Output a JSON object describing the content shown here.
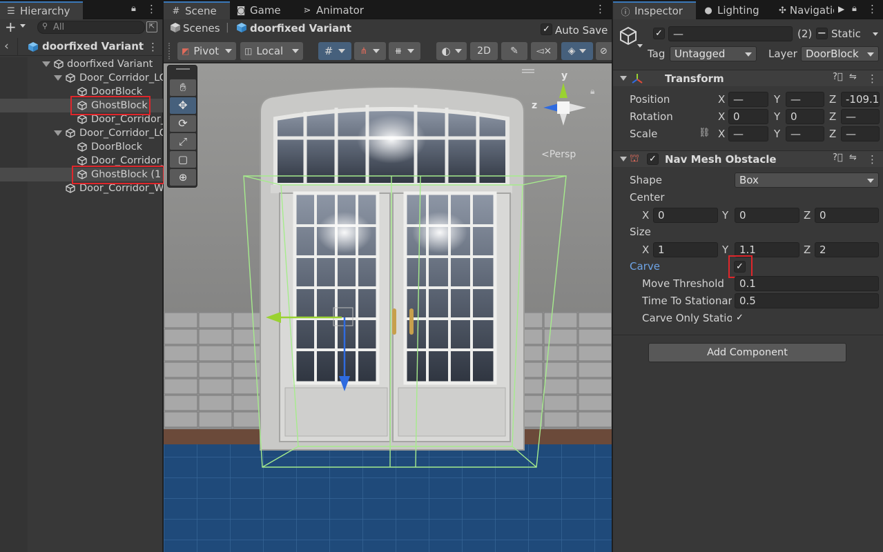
{
  "hierarchy": {
    "tab_label": "Hierarchy",
    "search_placeholder": "All",
    "breadcrumb": "doorfixed Variant",
    "rows": [
      {
        "label": "doorfixed Variant"
      },
      {
        "label": "Door_Corridor_LO"
      },
      {
        "label": "DoorBlock"
      },
      {
        "label": "GhostBlock"
      },
      {
        "label": "Door_Corridor_"
      },
      {
        "label": "Door_Corridor_LO"
      },
      {
        "label": "DoorBlock"
      },
      {
        "label": "Door_Corridor_"
      },
      {
        "label": "GhostBlock (1"
      },
      {
        "label": "Door_Corridor_Wa"
      }
    ]
  },
  "scene": {
    "tabs": [
      {
        "label": "Scene"
      },
      {
        "label": "Game"
      },
      {
        "label": "Animator"
      }
    ],
    "breadcrumb_scenes": "Scenes",
    "breadcrumb_prefab": "doorfixed Variant",
    "auto_save_label": "Auto Save",
    "auto_save_checked": true,
    "toolbar": {
      "pivot": "Pivot",
      "local": "Local",
      "mode_2d": "2D"
    },
    "gizmo": {
      "y_label": "y",
      "z_label": "z",
      "projection": "<Persp"
    }
  },
  "inspector": {
    "tabs": [
      {
        "label": "Inspector"
      },
      {
        "label": "Lighting"
      },
      {
        "label": "Navigatio"
      }
    ],
    "object": {
      "name_value": "—",
      "count": "(2)",
      "static_label": "Static",
      "tag_label": "Tag",
      "tag_value": "Untagged",
      "layer_label": "Layer",
      "layer_value": "DoorBlock"
    },
    "transform": {
      "title": "Transform",
      "position_label": "Position",
      "rotation_label": "Rotation",
      "scale_label": "Scale",
      "position": {
        "x": "—",
        "y": "—",
        "z": "-109.1"
      },
      "rotation": {
        "x": "0",
        "y": "0",
        "z": "—"
      },
      "scale": {
        "x": "—",
        "y": "—",
        "z": "—"
      }
    },
    "navmesh": {
      "title": "Nav Mesh Obstacle",
      "shape_label": "Shape",
      "shape_value": "Box",
      "center_label": "Center",
      "center": {
        "x": "0",
        "y": "0",
        "z": "0"
      },
      "size_label": "Size",
      "size": {
        "x": "1",
        "y": "1.1",
        "z": "2"
      },
      "carve_label": "Carve",
      "carve_checked": true,
      "move_threshold_label": "Move Threshold",
      "move_threshold_value": "0.1",
      "time_to_stationary_label": "Time To Stationar",
      "time_to_stationary_value": "0.5",
      "carve_only_stationary_label": "Carve Only Statio",
      "carve_only_stationary_checked": true
    },
    "add_component_label": "Add Component"
  },
  "axis_labels": {
    "x": "X",
    "y": "Y",
    "z": "Z"
  },
  "colors": {
    "accent": "#3a79bb",
    "highlight_red": "#e0262b",
    "gizmo_x": "#a0d020",
    "gizmo_y": "#9ad231",
    "gizmo_z": "#2f6bdf",
    "navmesh_wire": "#9fe08a",
    "carve_label": "#6ea4e6"
  }
}
